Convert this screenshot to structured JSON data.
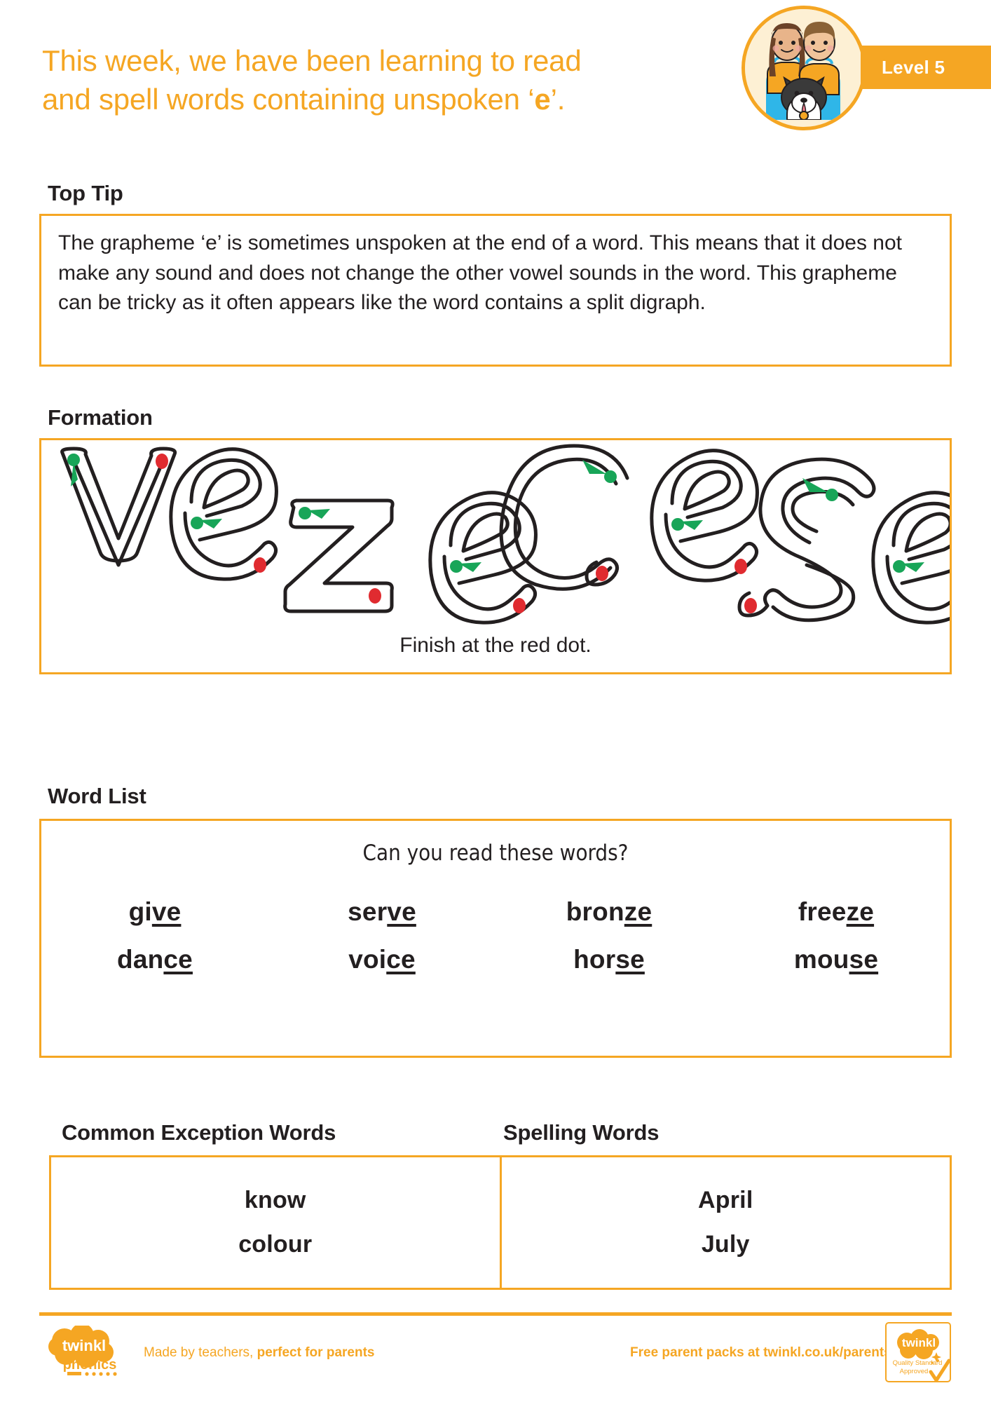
{
  "header": {
    "title_line1": "This week, we have been learning to read",
    "title_line2_pre": "and spell words containing unspoken ‘",
    "title_line2_bold": "e",
    "title_line2_post": "’.",
    "level_label": "Level 5",
    "illustration_name": "two-children-and-dog-illustration"
  },
  "top_tip": {
    "heading": "Top Tip",
    "body": "The grapheme ‘e’ is sometimes unspoken at the end of a word. This means that it does not make any sound and does not change the other vowel sounds in the word. This grapheme can be tricky as it often appears like the word contains a split digraph."
  },
  "formation": {
    "heading": "Formation",
    "caption": "Finish at the red dot.",
    "letters": [
      "ve",
      "ce",
      "ze",
      "se"
    ],
    "start_marker_color": "#18a558",
    "end_marker_color": "#e02b30",
    "outline_color": "#231f20"
  },
  "word_list": {
    "heading": "Word List",
    "prompt": "Can you read these words?",
    "rows": [
      [
        {
          "prefix": "gi",
          "suffix": "ve"
        },
        {
          "prefix": "ser",
          "suffix": "ve"
        },
        {
          "prefix": "bron",
          "suffix": "ze"
        },
        {
          "prefix": "free",
          "suffix": "ze"
        }
      ],
      [
        {
          "prefix": "dan",
          "suffix": "ce"
        },
        {
          "prefix": "voi",
          "suffix": "ce"
        },
        {
          "prefix": "hor",
          "suffix": "se"
        },
        {
          "prefix": "mou",
          "suffix": "se"
        }
      ]
    ]
  },
  "common_exception_words": {
    "heading": "Common Exception Words",
    "words": [
      "know",
      "colour"
    ]
  },
  "spelling_words": {
    "heading": "Spelling Words",
    "words": [
      "April",
      "July"
    ]
  },
  "footer": {
    "made_by_normal": "Made by teachers, ",
    "made_by_bold": "perfect for parents",
    "free_packs": "Free parent packs at twinkl.co.uk/parents",
    "logo_word": "twinkl",
    "logo_sub": "phonics",
    "approved_word": "twinkl",
    "approved_line1": "Quality Standard",
    "approved_line2": "Approved"
  },
  "colors": {
    "accent": "#f5a623",
    "ink": "#231f20",
    "green": "#18a558",
    "red": "#e02b30"
  }
}
